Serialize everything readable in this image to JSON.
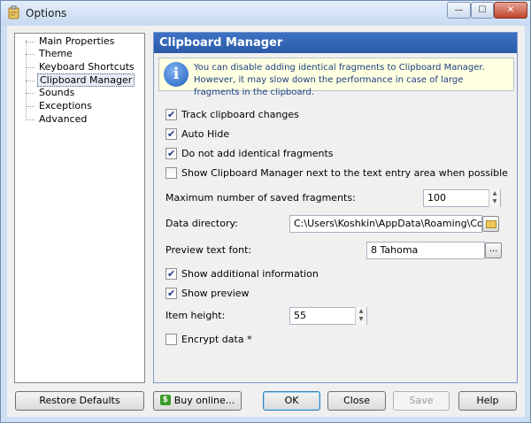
{
  "window": {
    "title": "Options",
    "controls": {
      "minimize": "—",
      "maximize": "☐",
      "close": "✕"
    }
  },
  "tree": {
    "items": [
      {
        "label": "Main Properties",
        "selected": false
      },
      {
        "label": "Theme",
        "selected": false
      },
      {
        "label": "Keyboard Shortcuts",
        "selected": false
      },
      {
        "label": "Clipboard Manager",
        "selected": true
      },
      {
        "label": "Sounds",
        "selected": false
      },
      {
        "label": "Exceptions",
        "selected": false
      },
      {
        "label": "Advanced",
        "selected": false
      }
    ]
  },
  "panel": {
    "title": "Clipboard Manager",
    "info": {
      "icon": "i",
      "text": "You can disable adding identical fragments to Clipboard Manager. However, it may slow down the performance in case of large fragments in the clipboard."
    },
    "options": {
      "track_changes": {
        "label": "Track clipboard changes",
        "checked": true
      },
      "auto_hide": {
        "label": "Auto Hide",
        "checked": true
      },
      "no_identical": {
        "label": "Do not add identical fragments",
        "checked": true
      },
      "show_next_to_entry": {
        "label": "Show Clipboard Manager next to the text entry area when possible",
        "checked": false
      },
      "show_additional": {
        "label": "Show additional information",
        "checked": true
      },
      "show_preview": {
        "label": "Show preview",
        "checked": true
      },
      "encrypt": {
        "label": "Encrypt data *",
        "checked": false
      }
    },
    "max_fragments": {
      "label": "Maximum number of saved fragments:",
      "value": "100"
    },
    "data_directory": {
      "label": "Data directory:",
      "value": "C:\\Users\\Koshkin\\AppData\\Roaming\\ComfortSo"
    },
    "preview_font": {
      "label": "Preview text font:",
      "value": "8 Tahoma",
      "browse": "..."
    },
    "item_height": {
      "label": "Item height:",
      "value": "55"
    }
  },
  "buttons": {
    "restore_defaults": "Restore Defaults",
    "buy_online": "Buy online...",
    "buy_icon": "$",
    "ok": "OK",
    "close": "Close",
    "save": "Save",
    "help": "Help"
  }
}
